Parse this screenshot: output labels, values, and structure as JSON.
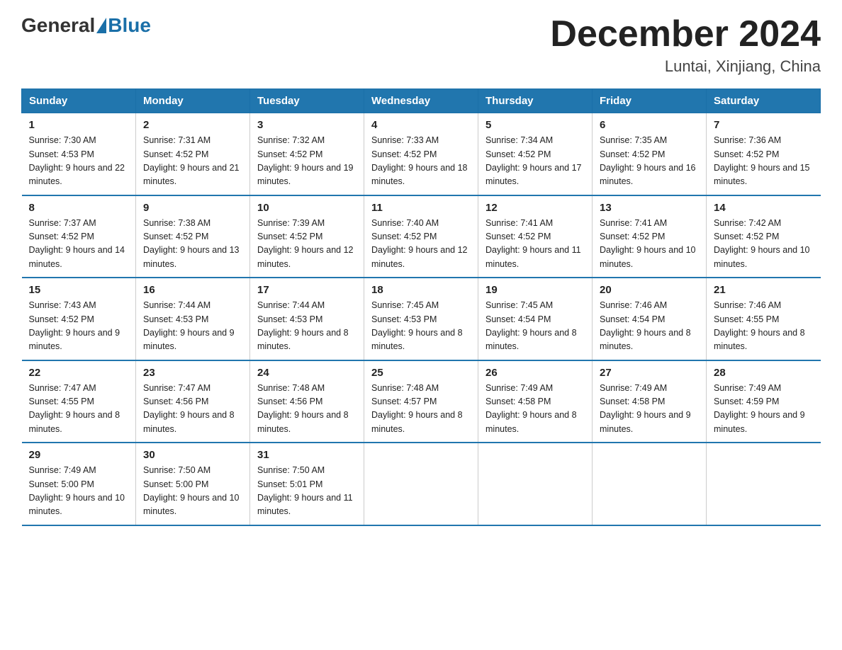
{
  "header": {
    "logo_general": "General",
    "logo_blue": "Blue",
    "title": "December 2024",
    "location": "Luntai, Xinjiang, China"
  },
  "columns": [
    "Sunday",
    "Monday",
    "Tuesday",
    "Wednesday",
    "Thursday",
    "Friday",
    "Saturday"
  ],
  "weeks": [
    [
      {
        "day": "1",
        "sunrise": "7:30 AM",
        "sunset": "4:53 PM",
        "daylight": "9 hours and 22 minutes."
      },
      {
        "day": "2",
        "sunrise": "7:31 AM",
        "sunset": "4:52 PM",
        "daylight": "9 hours and 21 minutes."
      },
      {
        "day": "3",
        "sunrise": "7:32 AM",
        "sunset": "4:52 PM",
        "daylight": "9 hours and 19 minutes."
      },
      {
        "day": "4",
        "sunrise": "7:33 AM",
        "sunset": "4:52 PM",
        "daylight": "9 hours and 18 minutes."
      },
      {
        "day": "5",
        "sunrise": "7:34 AM",
        "sunset": "4:52 PM",
        "daylight": "9 hours and 17 minutes."
      },
      {
        "day": "6",
        "sunrise": "7:35 AM",
        "sunset": "4:52 PM",
        "daylight": "9 hours and 16 minutes."
      },
      {
        "day": "7",
        "sunrise": "7:36 AM",
        "sunset": "4:52 PM",
        "daylight": "9 hours and 15 minutes."
      }
    ],
    [
      {
        "day": "8",
        "sunrise": "7:37 AM",
        "sunset": "4:52 PM",
        "daylight": "9 hours and 14 minutes."
      },
      {
        "day": "9",
        "sunrise": "7:38 AM",
        "sunset": "4:52 PM",
        "daylight": "9 hours and 13 minutes."
      },
      {
        "day": "10",
        "sunrise": "7:39 AM",
        "sunset": "4:52 PM",
        "daylight": "9 hours and 12 minutes."
      },
      {
        "day": "11",
        "sunrise": "7:40 AM",
        "sunset": "4:52 PM",
        "daylight": "9 hours and 12 minutes."
      },
      {
        "day": "12",
        "sunrise": "7:41 AM",
        "sunset": "4:52 PM",
        "daylight": "9 hours and 11 minutes."
      },
      {
        "day": "13",
        "sunrise": "7:41 AM",
        "sunset": "4:52 PM",
        "daylight": "9 hours and 10 minutes."
      },
      {
        "day": "14",
        "sunrise": "7:42 AM",
        "sunset": "4:52 PM",
        "daylight": "9 hours and 10 minutes."
      }
    ],
    [
      {
        "day": "15",
        "sunrise": "7:43 AM",
        "sunset": "4:52 PM",
        "daylight": "9 hours and 9 minutes."
      },
      {
        "day": "16",
        "sunrise": "7:44 AM",
        "sunset": "4:53 PM",
        "daylight": "9 hours and 9 minutes."
      },
      {
        "day": "17",
        "sunrise": "7:44 AM",
        "sunset": "4:53 PM",
        "daylight": "9 hours and 8 minutes."
      },
      {
        "day": "18",
        "sunrise": "7:45 AM",
        "sunset": "4:53 PM",
        "daylight": "9 hours and 8 minutes."
      },
      {
        "day": "19",
        "sunrise": "7:45 AM",
        "sunset": "4:54 PM",
        "daylight": "9 hours and 8 minutes."
      },
      {
        "day": "20",
        "sunrise": "7:46 AM",
        "sunset": "4:54 PM",
        "daylight": "9 hours and 8 minutes."
      },
      {
        "day": "21",
        "sunrise": "7:46 AM",
        "sunset": "4:55 PM",
        "daylight": "9 hours and 8 minutes."
      }
    ],
    [
      {
        "day": "22",
        "sunrise": "7:47 AM",
        "sunset": "4:55 PM",
        "daylight": "9 hours and 8 minutes."
      },
      {
        "day": "23",
        "sunrise": "7:47 AM",
        "sunset": "4:56 PM",
        "daylight": "9 hours and 8 minutes."
      },
      {
        "day": "24",
        "sunrise": "7:48 AM",
        "sunset": "4:56 PM",
        "daylight": "9 hours and 8 minutes."
      },
      {
        "day": "25",
        "sunrise": "7:48 AM",
        "sunset": "4:57 PM",
        "daylight": "9 hours and 8 minutes."
      },
      {
        "day": "26",
        "sunrise": "7:49 AM",
        "sunset": "4:58 PM",
        "daylight": "9 hours and 8 minutes."
      },
      {
        "day": "27",
        "sunrise": "7:49 AM",
        "sunset": "4:58 PM",
        "daylight": "9 hours and 9 minutes."
      },
      {
        "day": "28",
        "sunrise": "7:49 AM",
        "sunset": "4:59 PM",
        "daylight": "9 hours and 9 minutes."
      }
    ],
    [
      {
        "day": "29",
        "sunrise": "7:49 AM",
        "sunset": "5:00 PM",
        "daylight": "9 hours and 10 minutes."
      },
      {
        "day": "30",
        "sunrise": "7:50 AM",
        "sunset": "5:00 PM",
        "daylight": "9 hours and 10 minutes."
      },
      {
        "day": "31",
        "sunrise": "7:50 AM",
        "sunset": "5:01 PM",
        "daylight": "9 hours and 11 minutes."
      },
      null,
      null,
      null,
      null
    ]
  ]
}
